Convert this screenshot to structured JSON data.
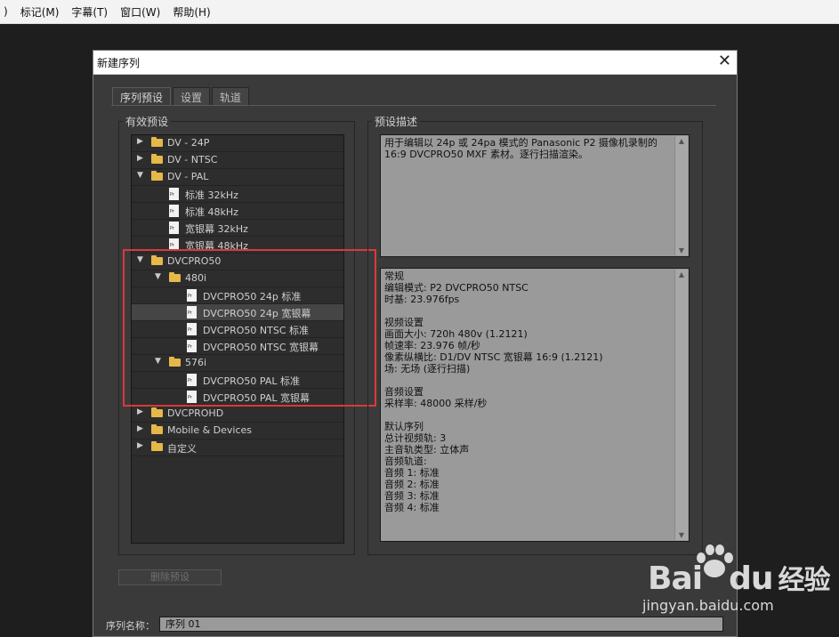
{
  "menubar": {
    "items": [
      ")",
      "标记(M)",
      "字幕(T)",
      "窗口(W)",
      "帮助(H)"
    ]
  },
  "dialog": {
    "title": "新建序列",
    "close_symbol": "✕",
    "tabs": [
      {
        "label": "序列预设",
        "active": true
      },
      {
        "label": "设置",
        "active": false
      },
      {
        "label": "轨道",
        "active": false
      }
    ],
    "available_presets_label": "有效预设",
    "preset_description_label": "预设描述",
    "tree": [
      {
        "label": "DV - 24P",
        "type": "folder",
        "level": 0,
        "expanded": false
      },
      {
        "label": "DV - NTSC",
        "type": "folder",
        "level": 0,
        "expanded": false
      },
      {
        "label": "DV - PAL",
        "type": "folder",
        "level": 0,
        "expanded": true
      },
      {
        "label": "标准 32kHz",
        "type": "file",
        "level": 1
      },
      {
        "label": "标准 48kHz",
        "type": "file",
        "level": 1
      },
      {
        "label": "宽银幕 32kHz",
        "type": "file",
        "level": 1
      },
      {
        "label": "宽银幕 48kHz",
        "type": "file",
        "level": 1
      },
      {
        "label": "DVCPRO50",
        "type": "folder",
        "level": 0,
        "expanded": true
      },
      {
        "label": "480i",
        "type": "folder",
        "level": 1,
        "expanded": true
      },
      {
        "label": "DVCPRO50 24p 标准",
        "type": "file",
        "level": 2
      },
      {
        "label": "DVCPRO50 24p 宽银幕",
        "type": "file",
        "level": 2,
        "selected": true
      },
      {
        "label": "DVCPRO50 NTSC 标准",
        "type": "file",
        "level": 2
      },
      {
        "label": "DVCPRO50 NTSC 宽银幕",
        "type": "file",
        "level": 2
      },
      {
        "label": "576i",
        "type": "folder",
        "level": 1,
        "expanded": true
      },
      {
        "label": "DVCPRO50 PAL 标准",
        "type": "file",
        "level": 2
      },
      {
        "label": "DVCPRO50 PAL 宽银幕",
        "type": "file",
        "level": 2
      },
      {
        "label": "DVCPROHD",
        "type": "folder",
        "level": 0,
        "expanded": false
      },
      {
        "label": "Mobile & Devices",
        "type": "folder",
        "level": 0,
        "expanded": false
      },
      {
        "label": "自定义",
        "type": "folder",
        "level": 0,
        "expanded": false
      }
    ],
    "description": "用于编辑以 24p 或 24pa 模式的 Panasonic P2 摄像机录制的 16:9 DVCPRO50 MXF 素材。逐行扫描渲染。",
    "details_lines": [
      "常规",
      " 编辑模式: P2 DVCPRO50 NTSC",
      " 时基: 23.976fps",
      "",
      "视频设置",
      " 画面大小: 720h 480v (1.2121)",
      " 帧速率: 23.976 帧/秒",
      " 像素纵横比: D1/DV NTSC 宽银幕 16:9 (1.2121)",
      " 场: 无场 (逐行扫描)",
      "",
      "音频设置",
      " 采样率: 48000 采样/秒",
      "",
      "默认序列",
      " 总计视频轨: 3",
      " 主音轨类型: 立体声",
      " 音频轨道:",
      " 音频 1: 标准",
      " 音频 2: 标准",
      " 音频 3: 标准",
      " 音频 4: 标准"
    ],
    "delete_preset_label": "删除预设",
    "sequence_name_label": "序列名称：",
    "sequence_name_value": "序列 01"
  },
  "watermark": {
    "logo_text": "Bai  du",
    "suffix": "经验",
    "url": "jingyan.baidu.com"
  },
  "colors": {
    "annotation": "#d93a3a",
    "folder": "#e6b84a",
    "dialog_bg": "#3a3a3a"
  }
}
